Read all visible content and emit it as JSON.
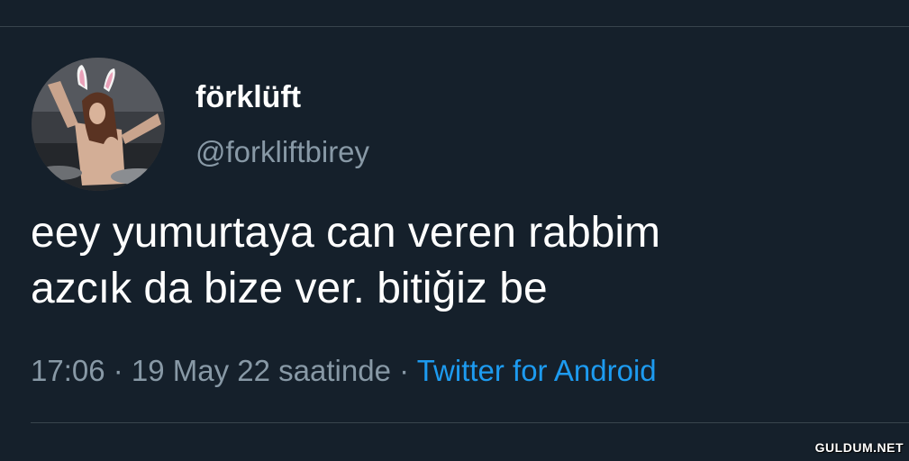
{
  "tweet": {
    "display_name": "förklüft",
    "handle": "@forkliftbirey",
    "text_lines": [
      "eey yumurtaya can veren rabbim",
      "azcık da bize ver. bitiğiz be"
    ],
    "time": "17:06",
    "separator": " · ",
    "date_text": "19 May 22 saatinde",
    "source": "Twitter for Android",
    "avatar_icon": "profile-photo-bunny-ears"
  },
  "watermark": "GULDUM.NET",
  "colors": {
    "background": "#15202b",
    "text": "#ffffff",
    "secondary_text": "#8899a6",
    "link": "#1d9bf0",
    "divider": "#38444d"
  }
}
